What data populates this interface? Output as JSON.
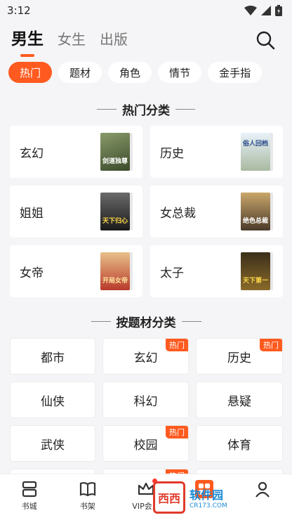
{
  "status": {
    "time": "3:12"
  },
  "top_tabs": [
    {
      "label": "男生"
    },
    {
      "label": "女生"
    },
    {
      "label": "出版"
    }
  ],
  "chips": [
    {
      "label": "热门"
    },
    {
      "label": "题材"
    },
    {
      "label": "角色"
    },
    {
      "label": "情节"
    },
    {
      "label": "金手指"
    }
  ],
  "hot_section": {
    "title": "热门分类"
  },
  "hot_categories": [
    {
      "label": "玄幻",
      "cover_text": "剑道独尊",
      "cover_color": "#5a6a4a"
    },
    {
      "label": "历史",
      "cover_text": "俗人回档",
      "cover_color": "#cfe0ef"
    },
    {
      "label": "姐姐",
      "cover_text": "天下归心",
      "cover_color": "#3a3a3a"
    },
    {
      "label": "女总裁",
      "cover_text": "绝色总裁",
      "cover_color": "#6b5a3a"
    },
    {
      "label": "女帝",
      "cover_text": "开局女帝",
      "cover_color": "#b83a2a"
    },
    {
      "label": "太子",
      "cover_text": "天下第一",
      "cover_color": "#2a2418"
    }
  ],
  "subject_section": {
    "title": "按题材分类"
  },
  "subjects": [
    {
      "label": "都市",
      "badge": ""
    },
    {
      "label": "玄幻",
      "badge": "热门"
    },
    {
      "label": "历史",
      "badge": "热门"
    },
    {
      "label": "仙侠",
      "badge": ""
    },
    {
      "label": "科幻",
      "badge": ""
    },
    {
      "label": "悬疑",
      "badge": ""
    },
    {
      "label": "武侠",
      "badge": ""
    },
    {
      "label": "校园",
      "badge": "热门"
    },
    {
      "label": "体育",
      "badge": ""
    }
  ],
  "partial_row_badge": "热门",
  "bottom_nav": [
    {
      "label": "书城"
    },
    {
      "label": "书架"
    },
    {
      "label": "VIP会员"
    },
    {
      "label": ""
    },
    {
      "label": ""
    }
  ],
  "watermark": {
    "box_text": "西西",
    "text": "软件园",
    "sub": "CR173.COM"
  },
  "colors": {
    "accent": "#ff5a1f",
    "background": "#f5f5f7"
  }
}
